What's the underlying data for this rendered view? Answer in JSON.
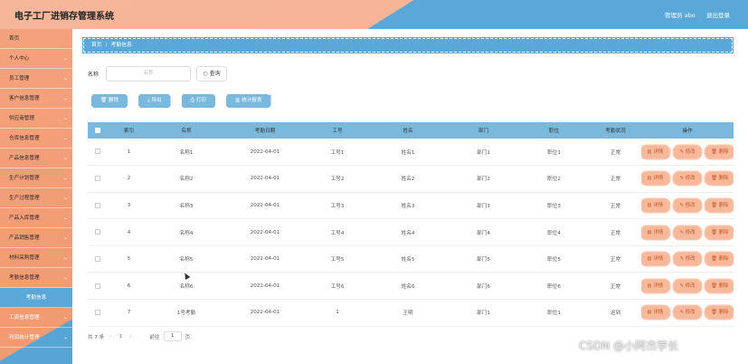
{
  "header": {
    "title": "电子工厂进销存管理系统",
    "user": "管理员 abo",
    "logout": "退出登录"
  },
  "sidebar": {
    "items": [
      {
        "label": "首页",
        "chev": false
      },
      {
        "label": "个人中心",
        "chev": true
      },
      {
        "label": "员工管理",
        "chev": true
      },
      {
        "label": "客户信息管理",
        "chev": true
      },
      {
        "label": "供应商管理",
        "chev": true
      },
      {
        "label": "仓库信息管理",
        "chev": true
      },
      {
        "label": "产品信息管理",
        "chev": true
      },
      {
        "label": "生产计划管理",
        "chev": true
      },
      {
        "label": "生产过程管理",
        "chev": true
      },
      {
        "label": "产品入库管理",
        "chev": true
      },
      {
        "label": "产品销售管理",
        "chev": true
      },
      {
        "label": "材料采购管理",
        "chev": true
      },
      {
        "label": "考勤信息管理",
        "chev": true
      },
      {
        "label": "考勤信息",
        "chev": false,
        "sub": true
      },
      {
        "label": "工资信息管理",
        "chev": true
      },
      {
        "label": "利润统计管理",
        "chev": true
      }
    ]
  },
  "breadcrumb": {
    "home": "首页",
    "sep": "/",
    "current": "考勤信息"
  },
  "search": {
    "label": "名称",
    "placeholder": "名称",
    "button": "查询",
    "icon": "search-icon"
  },
  "toolbar": {
    "delete": "删除",
    "delete_icon": "trash-icon",
    "export": "导出",
    "export_icon": "download-icon",
    "print": "打印",
    "print_icon": "printer-icon",
    "stats": "统计报表",
    "stats_icon": "chart-icon"
  },
  "table": {
    "headers": [
      "索引",
      "名称",
      "考勤日期",
      "工号",
      "姓名",
      "部门",
      "职位",
      "考勤状况",
      "操作"
    ],
    "rows": [
      [
        "1",
        "名称1",
        "2022-04-01",
        "工号1",
        "姓名1",
        "部门1",
        "职位1",
        "正常"
      ],
      [
        "2",
        "名称2",
        "2022-04-01",
        "工号2",
        "姓名2",
        "部门2",
        "职位2",
        "正常"
      ],
      [
        "3",
        "名称3",
        "2022-04-01",
        "工号3",
        "姓名3",
        "部门3",
        "职位3",
        "正常"
      ],
      [
        "4",
        "名称4",
        "2022-04-01",
        "工号4",
        "姓名4",
        "部门4",
        "职位4",
        "正常"
      ],
      [
        "5",
        "名称5",
        "2022-04-01",
        "工号5",
        "姓名5",
        "部门5",
        "职位5",
        "正常"
      ],
      [
        "6",
        "名称6",
        "2022-04-01",
        "工号6",
        "姓名6",
        "部门6",
        "职位6",
        "正常"
      ],
      [
        "7",
        "1号考勤",
        "2022-04-01",
        "1",
        "王明",
        "部门1",
        "职位1",
        "迟到"
      ]
    ],
    "actions": {
      "detail": "详情",
      "edit": "修改",
      "delete": "删除"
    }
  },
  "pagination": {
    "total": "共 7 条",
    "current": "1",
    "goto": "前往",
    "page_input": "1",
    "page_unit": "页"
  },
  "watermark": "CSDN @小阿杰学长",
  "colors": {
    "accent": "#5aa8d8",
    "peach": "#f4a27d",
    "table_header": "#7ab8de",
    "action_btn": "#f8b89a"
  }
}
